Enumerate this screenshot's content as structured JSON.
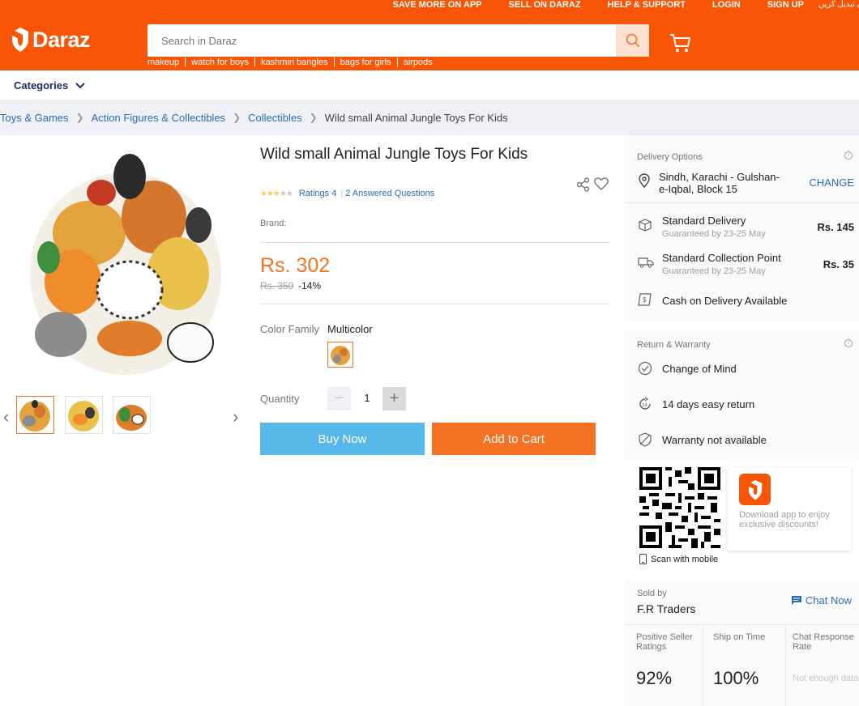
{
  "topnav": {
    "items": [
      "SAVE MORE ON APP",
      "SELL ON DARAZ",
      "HELP & SUPPORT",
      "LOGIN",
      "SIGN UP",
      "زبان تبدیل کریں"
    ]
  },
  "header": {
    "logo_text": "Daraz",
    "search_placeholder": "Search in Daraz",
    "hotwords": [
      "makeup",
      "watch for boys",
      "kashmiri bangles",
      "bags for girls",
      "airpods"
    ]
  },
  "categories_label": "Categories",
  "breadcrumb": {
    "items": [
      "Toys & Games",
      "Action Figures & Collectibles",
      "Collectibles"
    ],
    "current": "Wild small Animal Jungle Toys For Kids"
  },
  "product": {
    "title": "Wild small Animal Jungle Toys For Kids",
    "rating_fraction": 0.6,
    "ratings_text": "Ratings 4",
    "questions_text": "2 Answered Questions",
    "brand_label": "Brand:",
    "price": "Rs. 302",
    "old_price": "Rs. 350",
    "discount": "-14%",
    "color_family_label": "Color Family",
    "color_value": "Multicolor",
    "quantity_label": "Quantity",
    "quantity": "1",
    "buy_now": "Buy Now",
    "add_to_cart": "Add to Cart"
  },
  "delivery": {
    "title": "Delivery Options",
    "location": "Sindh, Karachi - Gulshan-e-Iqbal, Block 15",
    "change": "CHANGE",
    "standard": {
      "label": "Standard Delivery",
      "sub": "Guaranteed by 23-25 May",
      "price": "Rs. 145"
    },
    "collection": {
      "label": "Standard Collection Point",
      "sub": "Guaranteed by 23-25 May",
      "price": "Rs. 35"
    },
    "cod": "Cash on Delivery Available"
  },
  "warranty": {
    "title": "Return & Warranty",
    "items": [
      "Change of Mind",
      "14 days easy return",
      "Warranty not available"
    ]
  },
  "app_promo": {
    "scan_text": "Scan with mobile",
    "text": "Download app to enjoy exclusive discounts!"
  },
  "seller": {
    "sold_by_label": "Sold by",
    "name": "F.R Traders",
    "chat": "Chat Now",
    "metrics": [
      {
        "label": "Positive Seller Ratings",
        "value": "92%"
      },
      {
        "label": "Ship on Time",
        "value": "100%"
      },
      {
        "label": "Chat Response Rate",
        "value": "Not enough data"
      }
    ]
  },
  "colors": {
    "brand": "#f85606",
    "accent": "#f57224",
    "link": "#2a6db6",
    "buy": "#57b9e9"
  }
}
